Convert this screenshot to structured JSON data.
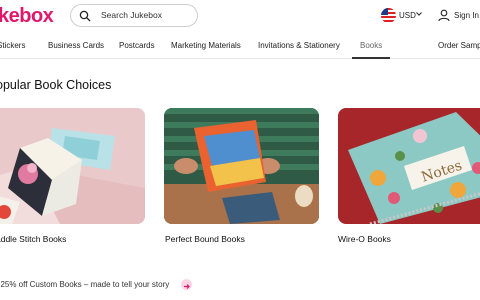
{
  "header": {
    "logo": "kebox",
    "search_placeholder": "Search Jukebox",
    "currency": "USD",
    "signin": "Sign In"
  },
  "nav": {
    "items": [
      {
        "label": "Stickers"
      },
      {
        "label": "Business Cards"
      },
      {
        "label": "Postcards"
      },
      {
        "label": "Marketing Materials"
      },
      {
        "label": "Invitations & Stationery"
      },
      {
        "label": "Books"
      },
      {
        "label": "Order Samp"
      }
    ]
  },
  "main": {
    "title": "opular Book Choices",
    "cards": [
      {
        "label": "addle Stitch Books"
      },
      {
        "label": "Perfect Bound Books"
      },
      {
        "label": "Wire-O Books"
      }
    ],
    "promo": "t 25% off Custom Books – made to tell your story"
  },
  "colors": {
    "brand": "#e0186c",
    "promo_button": "#ffd5e6"
  },
  "icons": [
    "search-icon",
    "us-flag-icon",
    "chevron-down-icon",
    "user-icon",
    "arrow-right-icon"
  ]
}
